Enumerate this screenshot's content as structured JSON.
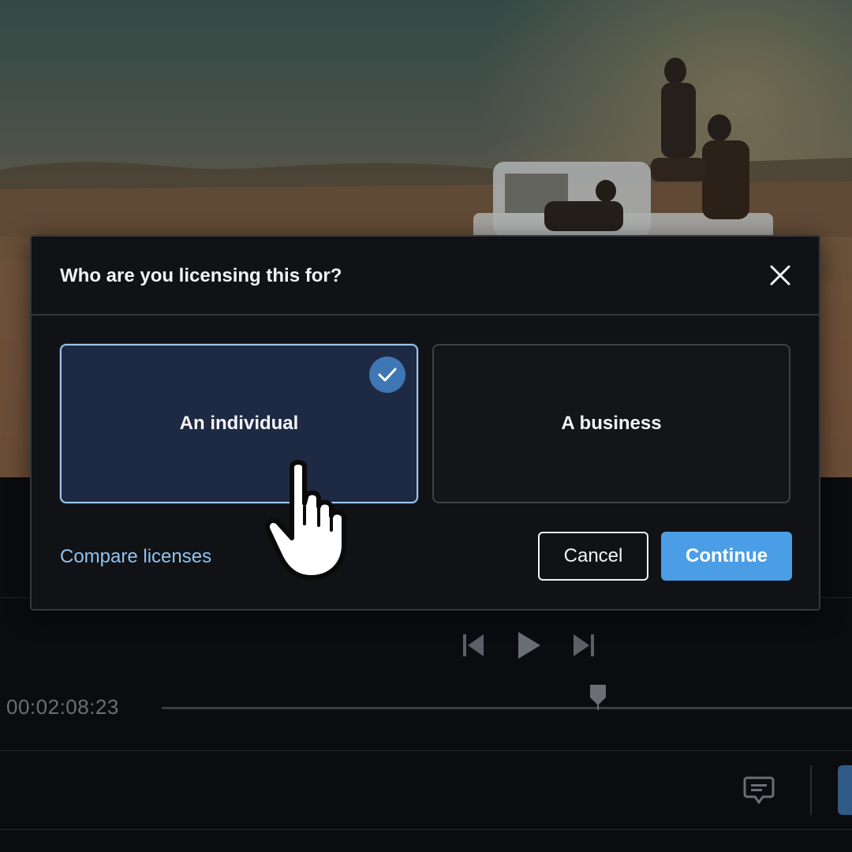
{
  "dialog": {
    "title": "Who are you licensing this for?",
    "close_icon": "close-icon",
    "options": [
      {
        "label": "An individual",
        "selected": true
      },
      {
        "label": "A business",
        "selected": false
      }
    ],
    "compare_link": "Compare licenses",
    "cancel_label": "Cancel",
    "continue_label": "Continue"
  },
  "player": {
    "timecode": "00:02:08:23",
    "controls": [
      "skip-back-icon",
      "play-icon",
      "skip-forward-icon"
    ],
    "playhead_icon": "playhead-marker-icon",
    "comment_icon": "comment-icon"
  },
  "colors": {
    "accent": "#4b9ee6",
    "selected_card_bg": "#1e2a43",
    "selected_card_border": "#9cc6ea",
    "link": "#8ec3f2",
    "modal_bg": "#111215",
    "page_bg": "#0b0c0f"
  }
}
